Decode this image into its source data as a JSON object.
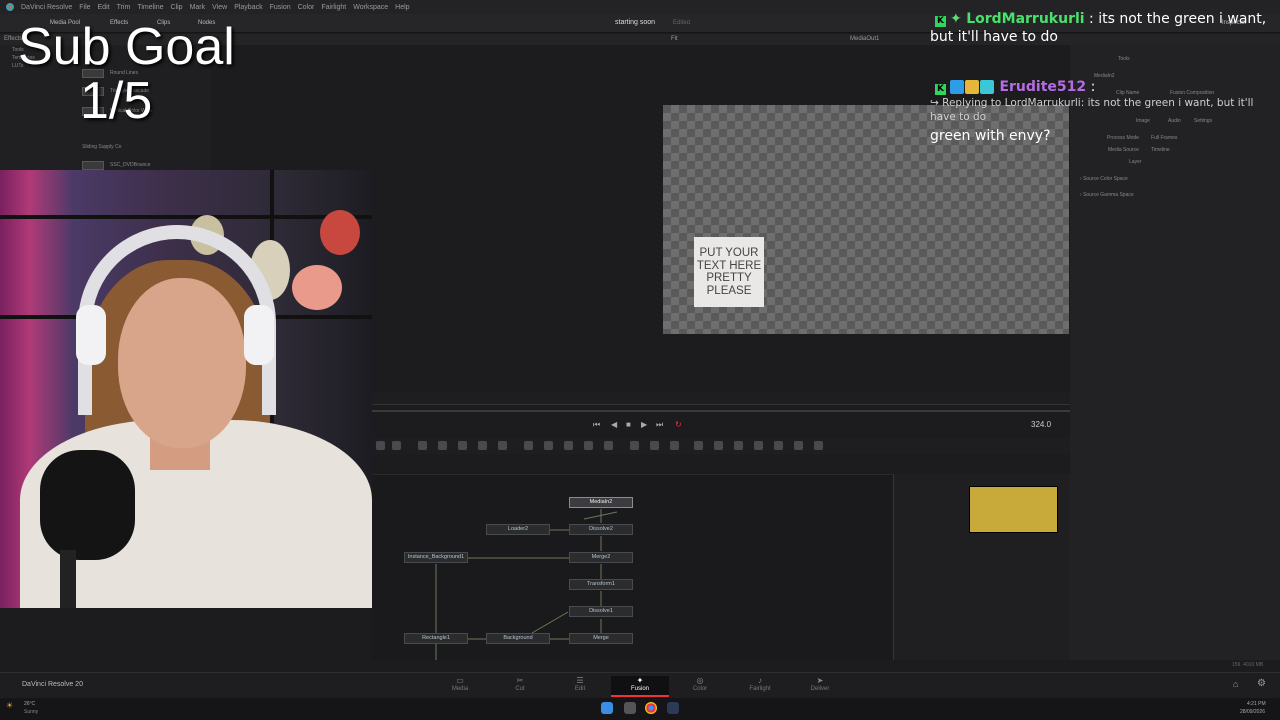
{
  "app": {
    "name": "DaVinci Resolve",
    "version_label": "DaVinci Resolve 20"
  },
  "menu": [
    "DaVinci Resolve",
    "File",
    "Edit",
    "Trim",
    "Timeline",
    "Clip",
    "Mark",
    "View",
    "Playback",
    "Fusion",
    "Color",
    "Fairlight",
    "Workspace",
    "Help"
  ],
  "toolbar": {
    "media_pool": "Media Pool",
    "effects": "Effects",
    "clips": "Clips",
    "nodes": "Nodes",
    "inspector": "Inspector"
  },
  "project": {
    "title": "starting soon",
    "status": "Edited"
  },
  "viewer": {
    "fit": "Fit",
    "output": "MediaOut1",
    "card_text": [
      "PUT YOUR",
      "TEXT HERE",
      "PRETTY",
      "PLEASE"
    ],
    "frame": "324.0"
  },
  "sidebar": {
    "items": [
      "Tools",
      "Templates",
      "LUTs"
    ],
    "header": "Effects"
  },
  "effects": [
    {
      "name": "Round Lines"
    },
    {
      "name": "Triangle Cascade"
    },
    {
      "name": "Vertical Color Wipe"
    },
    {
      "name": "Sliding Supply Co"
    },
    {
      "name": "SSC_DVDBounce"
    }
  ],
  "inspector": {
    "tabs": [
      "Tools"
    ],
    "node": "MediaIn2",
    "fields": [
      {
        "label": "Clip Name",
        "value": "Fusion Composition"
      },
      {
        "label": "Process Mode",
        "value": "Full Frames"
      },
      {
        "label": "Media Source",
        "value": "Timeline"
      },
      {
        "label": "Layer",
        "value": ""
      }
    ],
    "subtabs": [
      "Image",
      "Audio",
      "Settings"
    ],
    "sections": [
      "Source Color Space",
      "Source Gamma Space"
    ]
  },
  "nodes": {
    "mediain2": "MediaIn2",
    "loader2": "Loader2",
    "dissolve2": "Dissolve2",
    "instance_bg": "Instance_Background1",
    "merge2": "Merge2",
    "transform1": "Transform1",
    "dissolve1": "Dissolve1",
    "rectangle1": "Rectangle1",
    "background": "Background",
    "merge": "Merge"
  },
  "pages": [
    "Media",
    "Cut",
    "Edit",
    "Fusion",
    "Color",
    "Fairlight",
    "Deliver"
  ],
  "active_page": "Fusion",
  "overlay": {
    "subgoal_label": "Sub Goal",
    "subgoal_progress": "1/5"
  },
  "chat": [
    {
      "user": "LordMarrukurli",
      "message": ": its not the green i want, but it'll have to do"
    },
    {
      "user": "Erudite512",
      "message": ":",
      "reply": "↪ Replying to LordMarrukurli: its not the green i want, but it'll have to do",
      "body": "green with envy?"
    }
  ],
  "taskbar": {
    "weather_temp": "26°C",
    "weather_desc": "Sunny",
    "time": "4:21 PM",
    "date": "28/09/2026"
  },
  "status_right": "159.  4010 MB",
  "colors": {
    "accent_red": "#e33333",
    "swatch_yellow": "#c7aa3a",
    "chat_green": "#48e16b",
    "chat_purple": "#b56ce4"
  }
}
